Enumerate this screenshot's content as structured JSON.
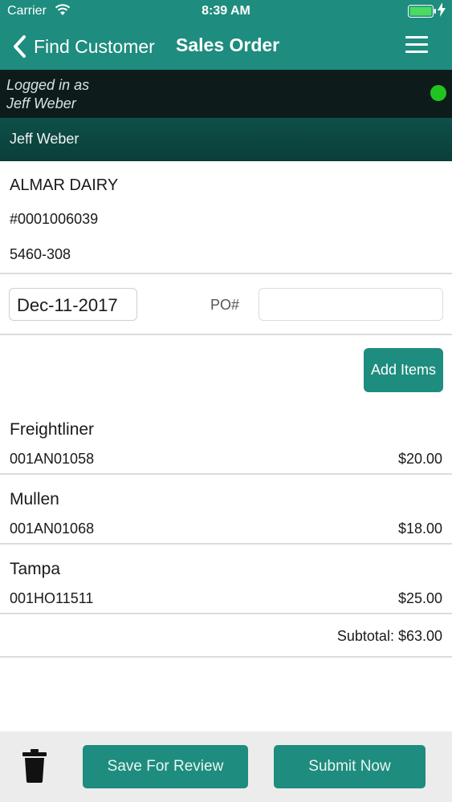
{
  "status_bar": {
    "carrier": "Carrier",
    "time": "8:39 AM",
    "wifi_icon": "wifi-icon",
    "battery_icon": "battery-charging-icon"
  },
  "nav": {
    "back_label": "Find Customer",
    "title": "Sales Order",
    "menu_icon": "hamburger-menu-icon"
  },
  "session": {
    "logged_in_line1": "Logged in as",
    "logged_in_line2": "Jeff Weber",
    "status_color": "#21c41f",
    "user_name": "Jeff Weber"
  },
  "customer": {
    "name": "ALMAR DAIRY",
    "number": "#0001006039",
    "code": "5460-308"
  },
  "order": {
    "date": "Dec-11-2017",
    "po_label": "PO#",
    "po_value": "",
    "add_items_label": "Add Items",
    "items": [
      {
        "name": "Freightliner",
        "code": "001AN01058",
        "price": "$20.00"
      },
      {
        "name": "Mullen",
        "code": "001AN01068",
        "price": "$18.00"
      },
      {
        "name": "Tampa",
        "code": "001HO11511",
        "price": "$25.00"
      }
    ],
    "subtotal": "Subtotal: $63.00"
  },
  "footer": {
    "delete_icon": "trash-icon",
    "save_label": "Save For Review",
    "submit_label": "Submit Now"
  },
  "colors": {
    "accent": "#1e8c7e",
    "session_bar": "#0d1c1b",
    "user_bar": "#0e5049"
  }
}
